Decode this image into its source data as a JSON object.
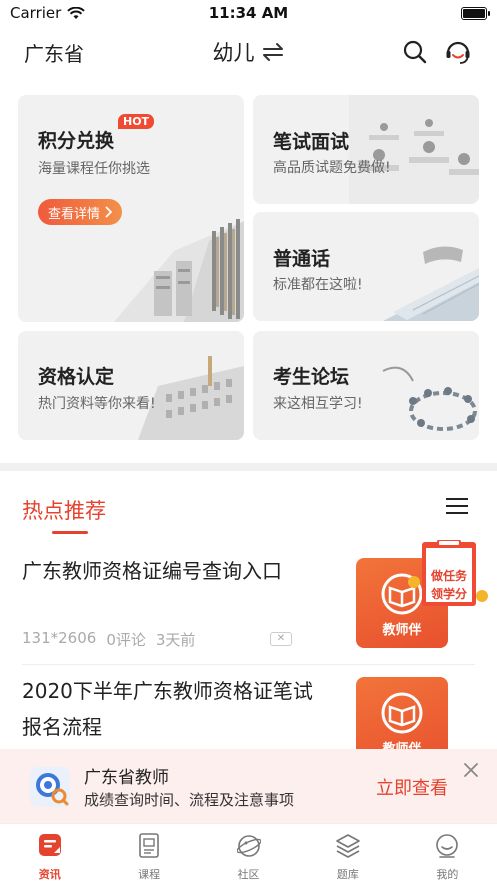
{
  "status_bar": {
    "carrier": "Carrier",
    "time": "11:34 AM"
  },
  "header": {
    "province": "广东省",
    "level": "幼儿"
  },
  "cards": {
    "points": {
      "title": "积分兑换",
      "subtitle": "海量课程任你挑选",
      "badge": "HOT",
      "button": "查看详情"
    },
    "exam": {
      "title": "笔试面试",
      "subtitle": "高品质试题免费做!"
    },
    "mandarin": {
      "title": "普通话",
      "subtitle": "标准都在这啦!"
    },
    "qualification": {
      "title": "资格认定",
      "subtitle": "热门资料等你来看!"
    },
    "forum": {
      "title": "考生论坛",
      "subtitle": "来这相互学习!"
    }
  },
  "hot": {
    "title": "热点推荐"
  },
  "articles": [
    {
      "title": "广东教师资格证编号查询入口",
      "views": "131*2606",
      "comments": "0评论",
      "time": "3天前",
      "brand": "教师伴"
    },
    {
      "title": "2020下半年广东教师资格证笔试报名流程",
      "brand": "教师伴"
    }
  ],
  "task_float": {
    "line1": "做任务",
    "line2": "领学分"
  },
  "promo": {
    "title": "广东省教师",
    "subtitle": "成绩查询时间、流程及注意事项",
    "action": "立即查看"
  },
  "tabs": [
    {
      "label": "资讯",
      "icon": "news-icon",
      "active": true
    },
    {
      "label": "课程",
      "icon": "course-icon",
      "active": false
    },
    {
      "label": "社区",
      "icon": "community-icon",
      "active": false
    },
    {
      "label": "题库",
      "icon": "question-bank-icon",
      "active": false
    },
    {
      "label": "我的",
      "icon": "profile-icon",
      "active": false
    }
  ],
  "colors": {
    "accent": "#e5432e",
    "card_bg": "#f1f1f1",
    "promo_bg": "#fdefee"
  }
}
